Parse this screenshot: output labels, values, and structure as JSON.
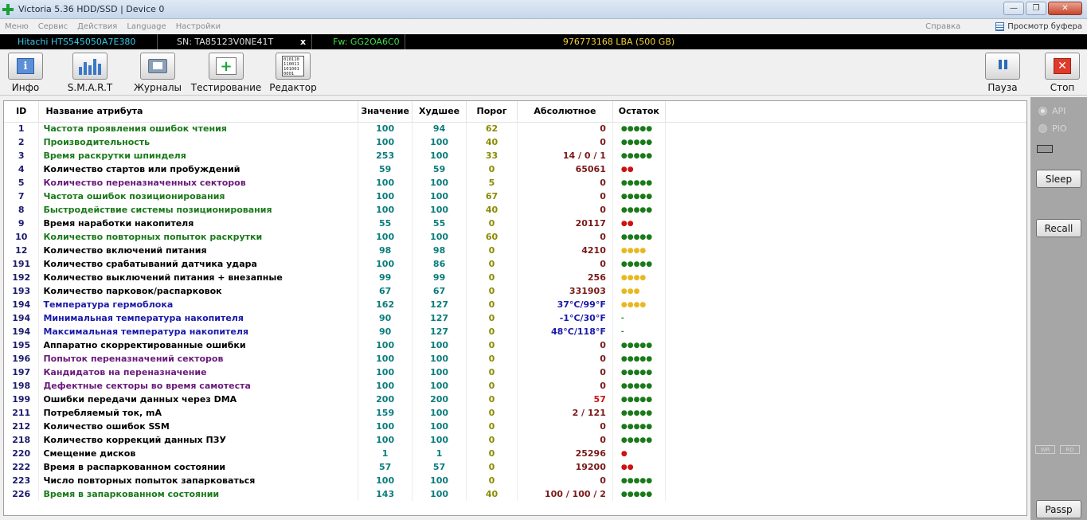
{
  "window": {
    "title": "Victoria 5.36 HDD/SSD | Device 0",
    "minimize": "—",
    "restore": "❐",
    "close": "✕"
  },
  "menu": {
    "items": [
      "Меню",
      "Сервис",
      "Действия",
      "Language",
      "Настройки"
    ],
    "help": "Справка",
    "buffer": "Просмотр буфера"
  },
  "device": {
    "model": "Hitachi HTS545050A7E380",
    "serial": "SN: TA85123V0NE41T",
    "eject": "x",
    "firmware": "Fw: GG2OA6C0",
    "lba": "976773168 LBA (500 GB)"
  },
  "toolbar": {
    "info": "Инфо",
    "smart": "S.M.A.R.T",
    "logs": "Журналы",
    "testing": "Тестирование",
    "editor": "Редактор",
    "pause": "Пауза",
    "stop": "Стоп",
    "info_glyph": "i",
    "test_glyph": "+",
    "stop_glyph": "✕",
    "editor_glyph": "010110\n110011\n101001\n0001"
  },
  "table": {
    "headers": {
      "id": "ID",
      "name": "Название атрибута",
      "value": "Значение",
      "worst": "Худшее",
      "threshold": "Порог",
      "raw": "Абсолютное",
      "remaining": "Остаток"
    },
    "rows": [
      {
        "id": "1",
        "name": "Частота проявления ошибок чтения",
        "value": "100",
        "worst": "94",
        "threshold": "62",
        "raw": "0",
        "remaining": "●●●●●",
        "name_color": "#1a7a1a",
        "rem_color": "#1a7a1a"
      },
      {
        "id": "2",
        "name": "Производительность",
        "value": "100",
        "worst": "100",
        "threshold": "40",
        "raw": "0",
        "remaining": "●●●●●",
        "name_color": "#1a7a1a",
        "rem_color": "#1a7a1a"
      },
      {
        "id": "3",
        "name": "Время раскрутки шпинделя",
        "value": "253",
        "worst": "100",
        "threshold": "33",
        "raw": "14 / 0 / 1",
        "remaining": "●●●●●",
        "name_color": "#1a7a1a",
        "rem_color": "#1a7a1a"
      },
      {
        "id": "4",
        "name": "Количество стартов или пробуждений",
        "value": "59",
        "worst": "59",
        "threshold": "0",
        "raw": "65061",
        "remaining": "●●",
        "name_color": "#000000",
        "rem_color": "#d01010"
      },
      {
        "id": "5",
        "name": "Количество переназначенных секторов",
        "value": "100",
        "worst": "100",
        "threshold": "5",
        "raw": "0",
        "remaining": "●●●●●",
        "name_color": "#6a1a7a",
        "rem_color": "#1a7a1a"
      },
      {
        "id": "7",
        "name": "Частота ошибок позиционирования",
        "value": "100",
        "worst": "100",
        "threshold": "67",
        "raw": "0",
        "remaining": "●●●●●",
        "name_color": "#1a7a1a",
        "rem_color": "#1a7a1a"
      },
      {
        "id": "8",
        "name": "Быстродействие системы позиционирования",
        "value": "100",
        "worst": "100",
        "threshold": "40",
        "raw": "0",
        "remaining": "●●●●●",
        "name_color": "#1a7a1a",
        "rem_color": "#1a7a1a"
      },
      {
        "id": "9",
        "name": "Время наработки накопителя",
        "value": "55",
        "worst": "55",
        "threshold": "0",
        "raw": "20117",
        "remaining": "●●",
        "name_color": "#000000",
        "rem_color": "#d01010"
      },
      {
        "id": "10",
        "name": "Количество повторных попыток раскрутки",
        "value": "100",
        "worst": "100",
        "threshold": "60",
        "raw": "0",
        "remaining": "●●●●●",
        "name_color": "#1a7a1a",
        "rem_color": "#1a7a1a"
      },
      {
        "id": "12",
        "name": "Количество включений питания",
        "value": "98",
        "worst": "98",
        "threshold": "0",
        "raw": "4210",
        "remaining": "●●●●",
        "name_color": "#000000",
        "rem_color": "#e8b820"
      },
      {
        "id": "191",
        "name": "Количество срабатываний датчика удара",
        "value": "100",
        "worst": "86",
        "threshold": "0",
        "raw": "0",
        "remaining": "●●●●●",
        "name_color": "#000000",
        "rem_color": "#1a7a1a"
      },
      {
        "id": "192",
        "name": "Количество выключений питания + внезапные",
        "value": "99",
        "worst": "99",
        "threshold": "0",
        "raw": "256",
        "remaining": "●●●●",
        "name_color": "#000000",
        "rem_color": "#e8b820"
      },
      {
        "id": "193",
        "name": "Количество парковок/распарковок",
        "value": "67",
        "worst": "67",
        "threshold": "0",
        "raw": "331903",
        "remaining": "●●●",
        "name_color": "#000000",
        "rem_color": "#e8b820"
      },
      {
        "id": "194",
        "name": "Температура гермоблока",
        "value": "162",
        "worst": "127",
        "threshold": "0",
        "raw": "37°C/99°F",
        "remaining": "●●●●",
        "name_color": "#1a1aaa",
        "rem_color": "#e8b820",
        "raw_color": "#1a1aaa"
      },
      {
        "id": "194",
        "name": "Минимальная температура накопителя",
        "value": "90",
        "worst": "127",
        "threshold": "0",
        "raw": "-1°C/30°F",
        "remaining": "-",
        "name_color": "#1a1aaa",
        "rem_color": "#1a7a1a",
        "raw_color": "#1a1aaa"
      },
      {
        "id": "194",
        "name": "Максимальная температура накопителя",
        "value": "90",
        "worst": "127",
        "threshold": "0",
        "raw": "48°C/118°F",
        "remaining": "-",
        "name_color": "#1a1aaa",
        "rem_color": "#1a7a1a",
        "raw_color": "#1a1aaa"
      },
      {
        "id": "195",
        "name": "Аппаратно скорректированные ошибки",
        "value": "100",
        "worst": "100",
        "threshold": "0",
        "raw": "0",
        "remaining": "●●●●●",
        "name_color": "#000000",
        "rem_color": "#1a7a1a"
      },
      {
        "id": "196",
        "name": "Попыток переназначений секторов",
        "value": "100",
        "worst": "100",
        "threshold": "0",
        "raw": "0",
        "remaining": "●●●●●",
        "name_color": "#6a1a7a",
        "rem_color": "#1a7a1a"
      },
      {
        "id": "197",
        "name": "Кандидатов на переназначение",
        "value": "100",
        "worst": "100",
        "threshold": "0",
        "raw": "0",
        "remaining": "●●●●●",
        "name_color": "#6a1a7a",
        "rem_color": "#1a7a1a"
      },
      {
        "id": "198",
        "name": "Дефектные секторы во время самотеста",
        "value": "100",
        "worst": "100",
        "threshold": "0",
        "raw": "0",
        "remaining": "●●●●●",
        "name_color": "#6a1a7a",
        "rem_color": "#1a7a1a"
      },
      {
        "id": "199",
        "name": "Ошибки передачи данных через DMA",
        "value": "200",
        "worst": "200",
        "threshold": "0",
        "raw": "57",
        "remaining": "●●●●●",
        "name_color": "#000000",
        "rem_color": "#1a7a1a",
        "raw_color": "#d01010"
      },
      {
        "id": "211",
        "name": "Потребляемый ток, mA",
        "value": "159",
        "worst": "100",
        "threshold": "0",
        "raw": "2 / 121",
        "remaining": "●●●●●",
        "name_color": "#000000",
        "rem_color": "#1a7a1a"
      },
      {
        "id": "212",
        "name": "Количество ошибок SSM",
        "value": "100",
        "worst": "100",
        "threshold": "0",
        "raw": "0",
        "remaining": "●●●●●",
        "name_color": "#000000",
        "rem_color": "#1a7a1a"
      },
      {
        "id": "218",
        "name": "Количество коррекций данных ПЗУ",
        "value": "100",
        "worst": "100",
        "threshold": "0",
        "raw": "0",
        "remaining": "●●●●●",
        "name_color": "#000000",
        "rem_color": "#1a7a1a"
      },
      {
        "id": "220",
        "name": "Смещение дисков",
        "value": "1",
        "worst": "1",
        "threshold": "0",
        "raw": "25296",
        "remaining": "●",
        "name_color": "#000000",
        "rem_color": "#d01010"
      },
      {
        "id": "222",
        "name": "Время в распаркованном состоянии",
        "value": "57",
        "worst": "57",
        "threshold": "0",
        "raw": "19200",
        "remaining": "●●",
        "name_color": "#000000",
        "rem_color": "#d01010"
      },
      {
        "id": "223",
        "name": "Число повторных попыток запарковаться",
        "value": "100",
        "worst": "100",
        "threshold": "0",
        "raw": "0",
        "remaining": "●●●●●",
        "name_color": "#000000",
        "rem_color": "#1a7a1a"
      },
      {
        "id": "226",
        "name": "Время в запаркованном состоянии",
        "value": "143",
        "worst": "100",
        "threshold": "40",
        "raw": "100 / 100 / 2",
        "remaining": "●●●●●",
        "name_color": "#1a7a1a",
        "rem_color": "#1a7a1a"
      }
    ]
  },
  "side": {
    "api": "API",
    "pio": "PIO",
    "sleep": "Sleep",
    "recall": "Recall",
    "wr": "WR",
    "rd": "RD",
    "passp": "Passp"
  }
}
